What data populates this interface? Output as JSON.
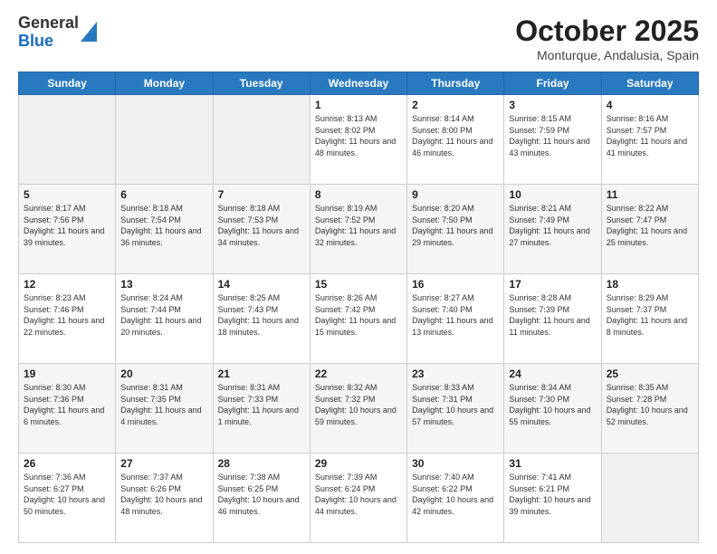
{
  "header": {
    "logo_general": "General",
    "logo_blue": "Blue",
    "month_title": "October 2025",
    "subtitle": "Monturque, Andalusia, Spain"
  },
  "weekdays": [
    "Sunday",
    "Monday",
    "Tuesday",
    "Wednesday",
    "Thursday",
    "Friday",
    "Saturday"
  ],
  "weeks": [
    [
      {
        "day": "",
        "info": ""
      },
      {
        "day": "",
        "info": ""
      },
      {
        "day": "",
        "info": ""
      },
      {
        "day": "1",
        "info": "Sunrise: 8:13 AM\nSunset: 8:02 PM\nDaylight: 11 hours\nand 48 minutes."
      },
      {
        "day": "2",
        "info": "Sunrise: 8:14 AM\nSunset: 8:00 PM\nDaylight: 11 hours\nand 46 minutes."
      },
      {
        "day": "3",
        "info": "Sunrise: 8:15 AM\nSunset: 7:59 PM\nDaylight: 11 hours\nand 43 minutes."
      },
      {
        "day": "4",
        "info": "Sunrise: 8:16 AM\nSunset: 7:57 PM\nDaylight: 11 hours\nand 41 minutes."
      }
    ],
    [
      {
        "day": "5",
        "info": "Sunrise: 8:17 AM\nSunset: 7:56 PM\nDaylight: 11 hours\nand 39 minutes."
      },
      {
        "day": "6",
        "info": "Sunrise: 8:18 AM\nSunset: 7:54 PM\nDaylight: 11 hours\nand 36 minutes."
      },
      {
        "day": "7",
        "info": "Sunrise: 8:18 AM\nSunset: 7:53 PM\nDaylight: 11 hours\nand 34 minutes."
      },
      {
        "day": "8",
        "info": "Sunrise: 8:19 AM\nSunset: 7:52 PM\nDaylight: 11 hours\nand 32 minutes."
      },
      {
        "day": "9",
        "info": "Sunrise: 8:20 AM\nSunset: 7:50 PM\nDaylight: 11 hours\nand 29 minutes."
      },
      {
        "day": "10",
        "info": "Sunrise: 8:21 AM\nSunset: 7:49 PM\nDaylight: 11 hours\nand 27 minutes."
      },
      {
        "day": "11",
        "info": "Sunrise: 8:22 AM\nSunset: 7:47 PM\nDaylight: 11 hours\nand 25 minutes."
      }
    ],
    [
      {
        "day": "12",
        "info": "Sunrise: 8:23 AM\nSunset: 7:46 PM\nDaylight: 11 hours\nand 22 minutes."
      },
      {
        "day": "13",
        "info": "Sunrise: 8:24 AM\nSunset: 7:44 PM\nDaylight: 11 hours\nand 20 minutes."
      },
      {
        "day": "14",
        "info": "Sunrise: 8:25 AM\nSunset: 7:43 PM\nDaylight: 11 hours\nand 18 minutes."
      },
      {
        "day": "15",
        "info": "Sunrise: 8:26 AM\nSunset: 7:42 PM\nDaylight: 11 hours\nand 15 minutes."
      },
      {
        "day": "16",
        "info": "Sunrise: 8:27 AM\nSunset: 7:40 PM\nDaylight: 11 hours\nand 13 minutes."
      },
      {
        "day": "17",
        "info": "Sunrise: 8:28 AM\nSunset: 7:39 PM\nDaylight: 11 hours\nand 11 minutes."
      },
      {
        "day": "18",
        "info": "Sunrise: 8:29 AM\nSunset: 7:37 PM\nDaylight: 11 hours\nand 8 minutes."
      }
    ],
    [
      {
        "day": "19",
        "info": "Sunrise: 8:30 AM\nSunset: 7:36 PM\nDaylight: 11 hours\nand 6 minutes."
      },
      {
        "day": "20",
        "info": "Sunrise: 8:31 AM\nSunset: 7:35 PM\nDaylight: 11 hours\nand 4 minutes."
      },
      {
        "day": "21",
        "info": "Sunrise: 8:31 AM\nSunset: 7:33 PM\nDaylight: 11 hours\nand 1 minute."
      },
      {
        "day": "22",
        "info": "Sunrise: 8:32 AM\nSunset: 7:32 PM\nDaylight: 10 hours\nand 59 minutes."
      },
      {
        "day": "23",
        "info": "Sunrise: 8:33 AM\nSunset: 7:31 PM\nDaylight: 10 hours\nand 57 minutes."
      },
      {
        "day": "24",
        "info": "Sunrise: 8:34 AM\nSunset: 7:30 PM\nDaylight: 10 hours\nand 55 minutes."
      },
      {
        "day": "25",
        "info": "Sunrise: 8:35 AM\nSunset: 7:28 PM\nDaylight: 10 hours\nand 52 minutes."
      }
    ],
    [
      {
        "day": "26",
        "info": "Sunrise: 7:36 AM\nSunset: 6:27 PM\nDaylight: 10 hours\nand 50 minutes."
      },
      {
        "day": "27",
        "info": "Sunrise: 7:37 AM\nSunset: 6:26 PM\nDaylight: 10 hours\nand 48 minutes."
      },
      {
        "day": "28",
        "info": "Sunrise: 7:38 AM\nSunset: 6:25 PM\nDaylight: 10 hours\nand 46 minutes."
      },
      {
        "day": "29",
        "info": "Sunrise: 7:39 AM\nSunset: 6:24 PM\nDaylight: 10 hours\nand 44 minutes."
      },
      {
        "day": "30",
        "info": "Sunrise: 7:40 AM\nSunset: 6:22 PM\nDaylight: 10 hours\nand 42 minutes."
      },
      {
        "day": "31",
        "info": "Sunrise: 7:41 AM\nSunset: 6:21 PM\nDaylight: 10 hours\nand 39 minutes."
      },
      {
        "day": "",
        "info": ""
      }
    ]
  ]
}
